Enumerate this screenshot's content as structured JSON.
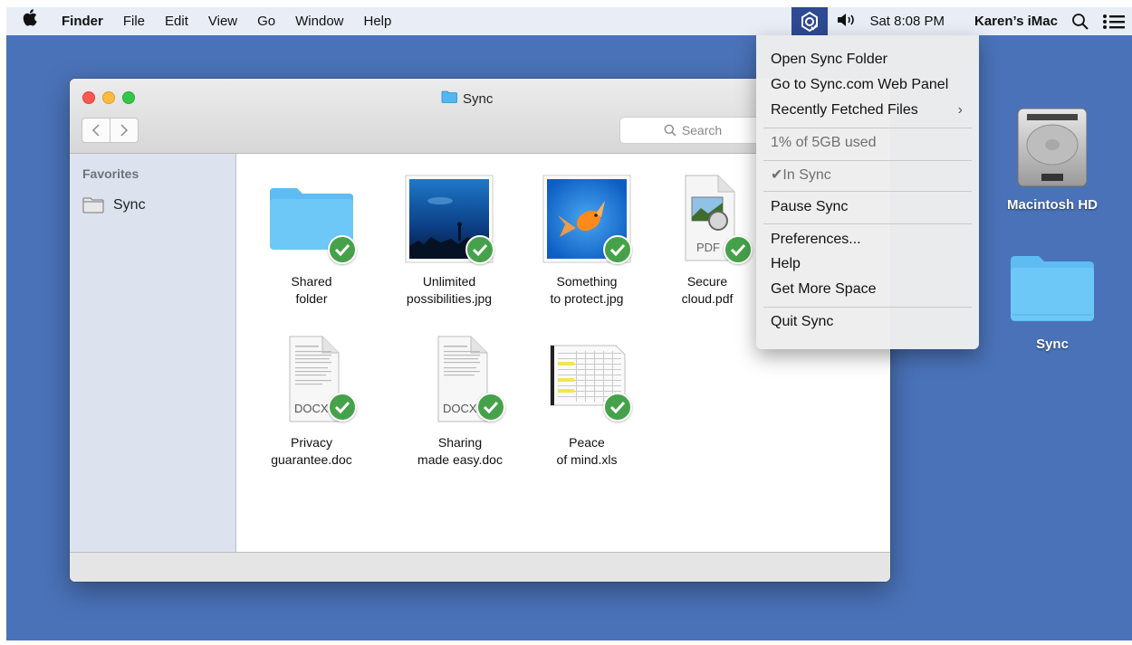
{
  "menubar": {
    "app": "Finder",
    "items": [
      "File",
      "Edit",
      "View",
      "Go",
      "Window",
      "Help"
    ],
    "clock": "Sat 8:08 PM",
    "user": "Karen’s iMac"
  },
  "window": {
    "title": "Sync",
    "search_placeholder": "Search",
    "sidebar_heading": "Favorites",
    "sidebar_item": "Sync"
  },
  "files": [
    {
      "line1": "Shared",
      "line2": "folder",
      "type": "folder"
    },
    {
      "line1": "Unlimited",
      "line2": "possibilities.jpg",
      "type": "photo-aquarium"
    },
    {
      "line1": "Something",
      "line2": "to protect.jpg",
      "type": "photo-goldfish"
    },
    {
      "line1": "Secure",
      "line2": "cloud.pdf",
      "type": "pdf",
      "badge": "PDF"
    },
    {
      "line1": "Privacy",
      "line2": "guarantee.doc",
      "type": "docx",
      "badge": "DOCX"
    },
    {
      "line1": "Sharing",
      "line2": "made easy.doc",
      "type": "docx",
      "badge": "DOCX"
    },
    {
      "line1": "Peace",
      "line2": "of mind.xls",
      "type": "spreadsheet"
    }
  ],
  "desktop": {
    "drive_label": "Macintosh HD",
    "folder_label": "Sync"
  },
  "sync_menu": {
    "open_folder": "Open Sync Folder",
    "web_panel": "Go to Sync.com Web Panel",
    "recent": "Recently Fetched Files",
    "usage": "1% of 5GB used",
    "status": "In Sync",
    "pause": "Pause Sync",
    "preferences": "Preferences...",
    "help": "Help",
    "more_space": "Get More Space",
    "quit": "Quit Sync"
  },
  "colors": {
    "desktop": "#4a72b8",
    "sync_icon_bg": "#2d4a92",
    "check": "#46a24a",
    "folder": "#5ebcf3"
  }
}
